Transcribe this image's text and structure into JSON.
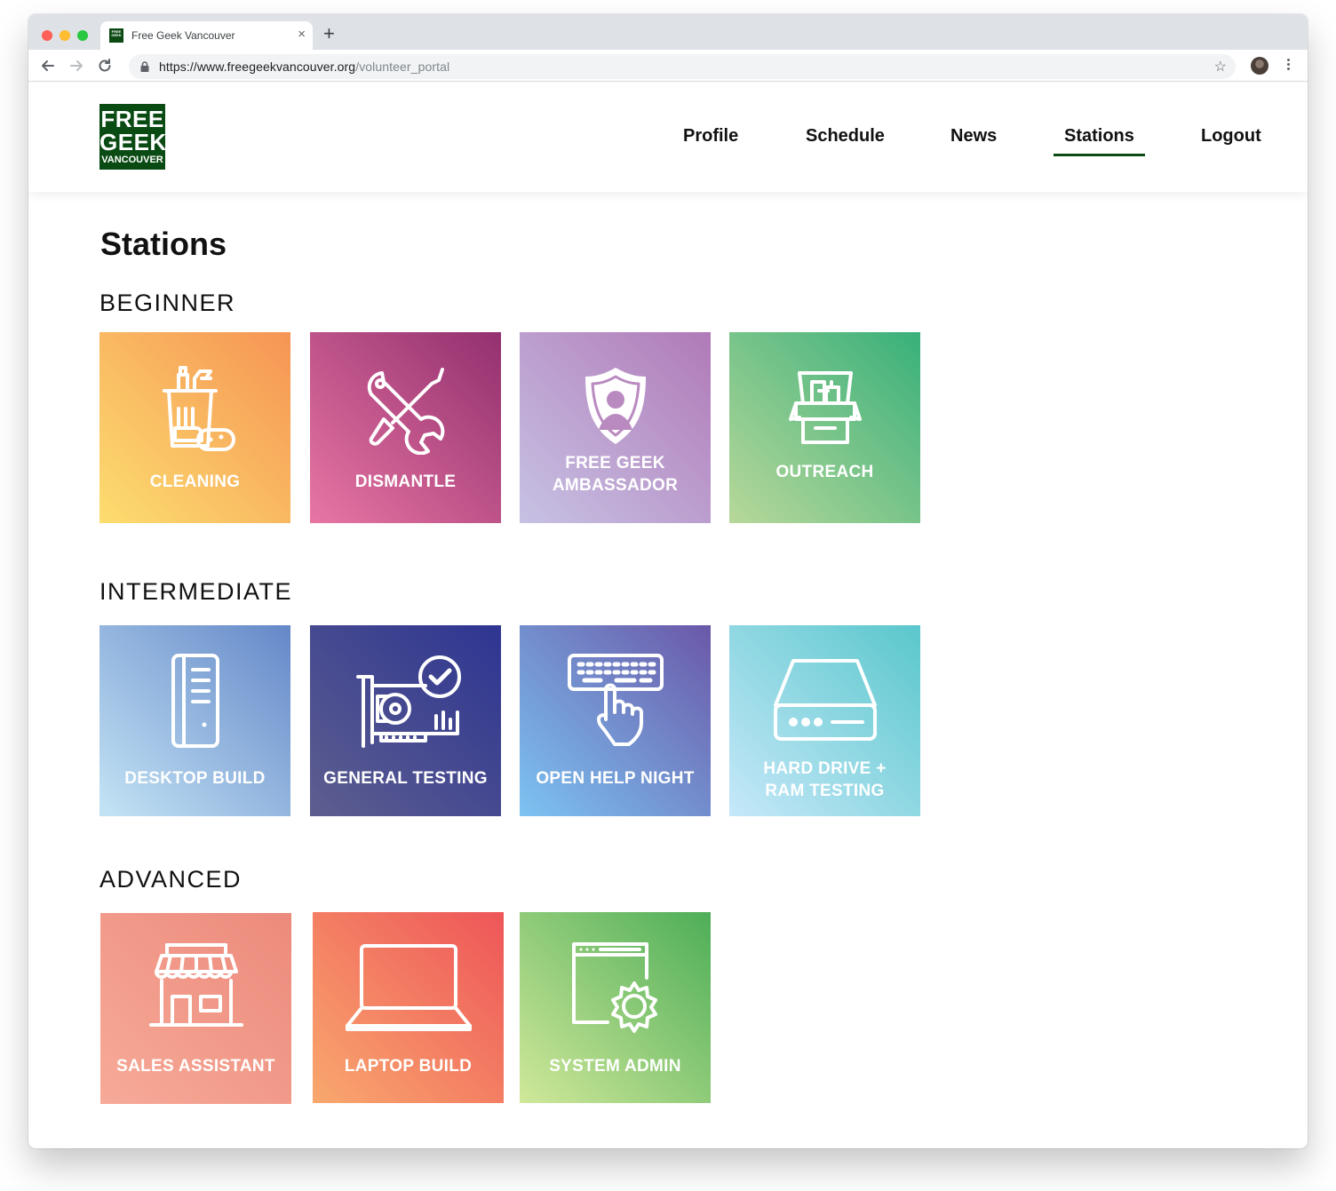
{
  "browser": {
    "tab_title": "Free Geek Vancouver",
    "tab_close": "×",
    "new_tab": "+",
    "url_base": "https://www.freegeekvancouver.org",
    "url_path": "/volunteer_portal",
    "favicon_text": "FREE GEEK"
  },
  "logo": {
    "line1": "FREE",
    "line2": "GEEK",
    "line3": "VANCOUVER"
  },
  "nav": {
    "items": [
      {
        "label": "Profile"
      },
      {
        "label": "Schedule"
      },
      {
        "label": "News"
      },
      {
        "label": "Stations",
        "active": true
      },
      {
        "label": "Logout"
      }
    ]
  },
  "page": {
    "title": "Stations"
  },
  "sections": [
    {
      "title": "BEGINNER",
      "stations": [
        {
          "label": "CLEANING",
          "icon": "cleaning-supplies-icon",
          "colors": [
            "#fcdd6f",
            "#f69454"
          ]
        },
        {
          "label": "DISMANTLE",
          "icon": "wrench-screwdriver-icon",
          "colors": [
            "#e776a3",
            "#93306f"
          ]
        },
        {
          "label_line1": "FREE GEEK",
          "label_line2": "AMBASSADOR",
          "icon": "shield-person-icon",
          "colors": [
            "#c7c2e4",
            "#b07ab8"
          ]
        },
        {
          "label": "OUTREACH",
          "icon": "open-box-icon",
          "colors": [
            "#b8d89a",
            "#38b07a"
          ]
        }
      ]
    },
    {
      "title": "INTERMEDIATE",
      "stations": [
        {
          "label": "DESKTOP BUILD",
          "icon": "desktop-tower-icon",
          "colors": [
            "#c4e4f5",
            "#6488c8"
          ]
        },
        {
          "label": "GENERAL TESTING",
          "icon": "graphics-card-check-icon",
          "colors": [
            "#5d5e8f",
            "#2e3591"
          ]
        },
        {
          "label": "OPEN HELP NIGHT",
          "icon": "keyboard-hand-icon",
          "colors": [
            "#7cc3f2",
            "#6a58a8"
          ]
        },
        {
          "label_line1": "HARD DRIVE +",
          "label_line2": "RAM TESTING",
          "icon": "hard-drive-icon",
          "colors": [
            "#c6e8f9",
            "#5ac7cc"
          ]
        }
      ]
    },
    {
      "title": "ADVANCED",
      "stations": [
        {
          "label": "SALES ASSISTANT",
          "icon": "storefront-icon",
          "colors": [
            "#f7aa98",
            "#ec8a7c"
          ]
        },
        {
          "label": "LAPTOP BUILD",
          "icon": "laptop-icon",
          "colors": [
            "#f9a86e",
            "#ee5558"
          ]
        },
        {
          "label": "SYSTEM ADMIN",
          "icon": "browser-gear-icon",
          "colors": [
            "#d0e89a",
            "#4eae58"
          ]
        }
      ]
    }
  ]
}
